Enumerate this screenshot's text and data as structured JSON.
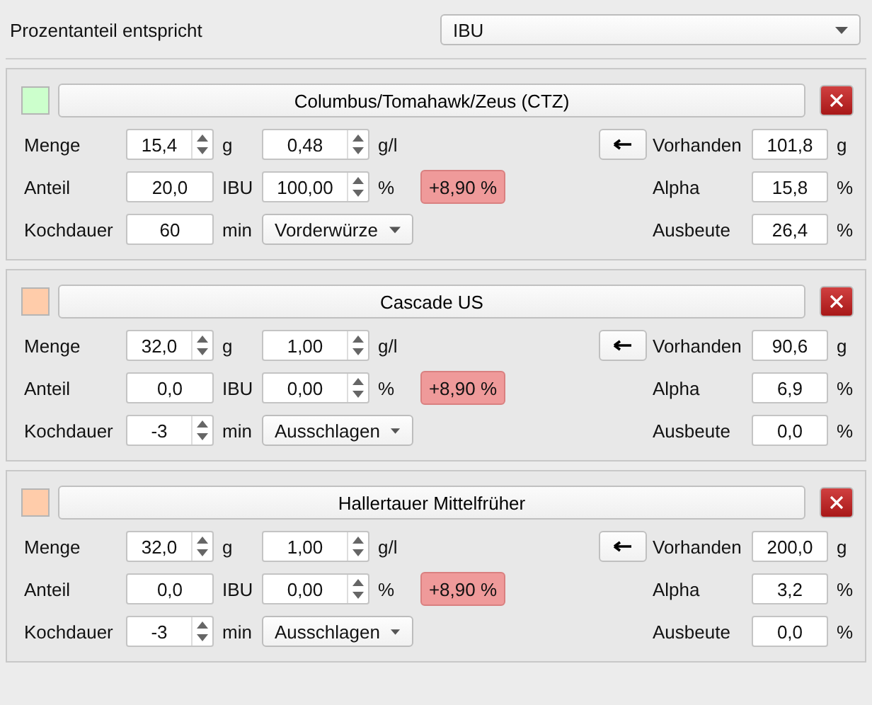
{
  "header": {
    "label": "Prozentanteil entspricht",
    "select": "IBU"
  },
  "hops": [
    {
      "color": "#ccffcc",
      "name": "Columbus/Tomahawk/Zeus (CTZ)",
      "amount_label": "Menge",
      "amount": {
        "value": "15,4",
        "spinner": true
      },
      "amount_unit": "g",
      "conc": {
        "value": "0,48",
        "spinner": true
      },
      "conc_unit": "g/l",
      "share_label": "Anteil",
      "share": {
        "value": "20,0",
        "spinner": false
      },
      "share_unit": "IBU",
      "percent": {
        "value": "100,00",
        "spinner": true
      },
      "percent_unit": "%",
      "deviation": "+8,90 %",
      "boil_label": "Kochdauer",
      "boil": {
        "value": "60",
        "spinner": false
      },
      "boil_unit": "min",
      "timing": "Vorderwürze",
      "stock_label": "Vorhanden",
      "stock": "101,8",
      "stock_unit": "g",
      "alpha_label": "Alpha",
      "alpha": "15,8",
      "alpha_unit": "%",
      "yield_label": "Ausbeute",
      "yield": "26,4",
      "yield_unit": "%"
    },
    {
      "color": "#ffccaa",
      "name": "Cascade US",
      "amount_label": "Menge",
      "amount": {
        "value": "32,0",
        "spinner": true
      },
      "amount_unit": "g",
      "conc": {
        "value": "1,00",
        "spinner": true
      },
      "conc_unit": "g/l",
      "share_label": "Anteil",
      "share": {
        "value": "0,0",
        "spinner": false
      },
      "share_unit": "IBU",
      "percent": {
        "value": "0,00",
        "spinner": true
      },
      "percent_unit": "%",
      "deviation": "+8,90 %",
      "boil_label": "Kochdauer",
      "boil": {
        "value": "-3",
        "spinner": true
      },
      "boil_unit": "min",
      "timing": "Ausschlagen",
      "stock_label": "Vorhanden",
      "stock": "90,6",
      "stock_unit": "g",
      "alpha_label": "Alpha",
      "alpha": "6,9",
      "alpha_unit": "%",
      "yield_label": "Ausbeute",
      "yield": "0,0",
      "yield_unit": "%"
    },
    {
      "color": "#ffccaa",
      "name": "Hallertauer Mittelfrüher",
      "amount_label": "Menge",
      "amount": {
        "value": "32,0",
        "spinner": true
      },
      "amount_unit": "g",
      "conc": {
        "value": "1,00",
        "spinner": true
      },
      "conc_unit": "g/l",
      "share_label": "Anteil",
      "share": {
        "value": "0,0",
        "spinner": false
      },
      "share_unit": "IBU",
      "percent": {
        "value": "0,00",
        "spinner": true
      },
      "percent_unit": "%",
      "deviation": "+8,90 %",
      "boil_label": "Kochdauer",
      "boil": {
        "value": "-3",
        "spinner": true
      },
      "boil_unit": "min",
      "timing": "Ausschlagen",
      "stock_label": "Vorhanden",
      "stock": "200,0",
      "stock_unit": "g",
      "alpha_label": "Alpha",
      "alpha": "3,2",
      "alpha_unit": "%",
      "yield_label": "Ausbeute",
      "yield": "0,0",
      "yield_unit": "%"
    }
  ]
}
